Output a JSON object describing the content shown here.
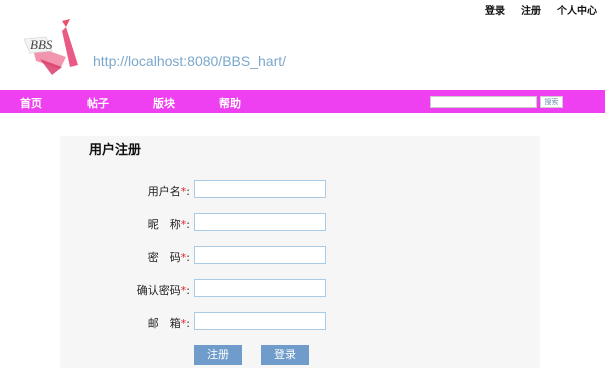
{
  "top_links": {
    "login": "登录",
    "register": "注册",
    "user_center": "个人中心"
  },
  "header": {
    "logo_text": "BBS",
    "url": "http://localhost:8080/BBS_hart/"
  },
  "nav": {
    "items": [
      "首页",
      "帖子",
      "版块",
      "帮助"
    ],
    "search_value": "",
    "search_button": "搜索"
  },
  "form": {
    "title": "用户注册",
    "required_mark": "*",
    "colon": ":",
    "fields": [
      {
        "label": "用户名",
        "value": ""
      },
      {
        "label": "昵　称",
        "value": ""
      },
      {
        "label": "密　码",
        "value": ""
      },
      {
        "label": "确认密码",
        "value": ""
      },
      {
        "label": "邮　箱",
        "value": ""
      }
    ],
    "submit_label": "注册",
    "login_label": "登录"
  },
  "colors": {
    "nav_bg": "#ee3ff0",
    "button_bg": "#6f9ccb",
    "required": "#d9262b",
    "url_text": "#7aa8cc"
  }
}
